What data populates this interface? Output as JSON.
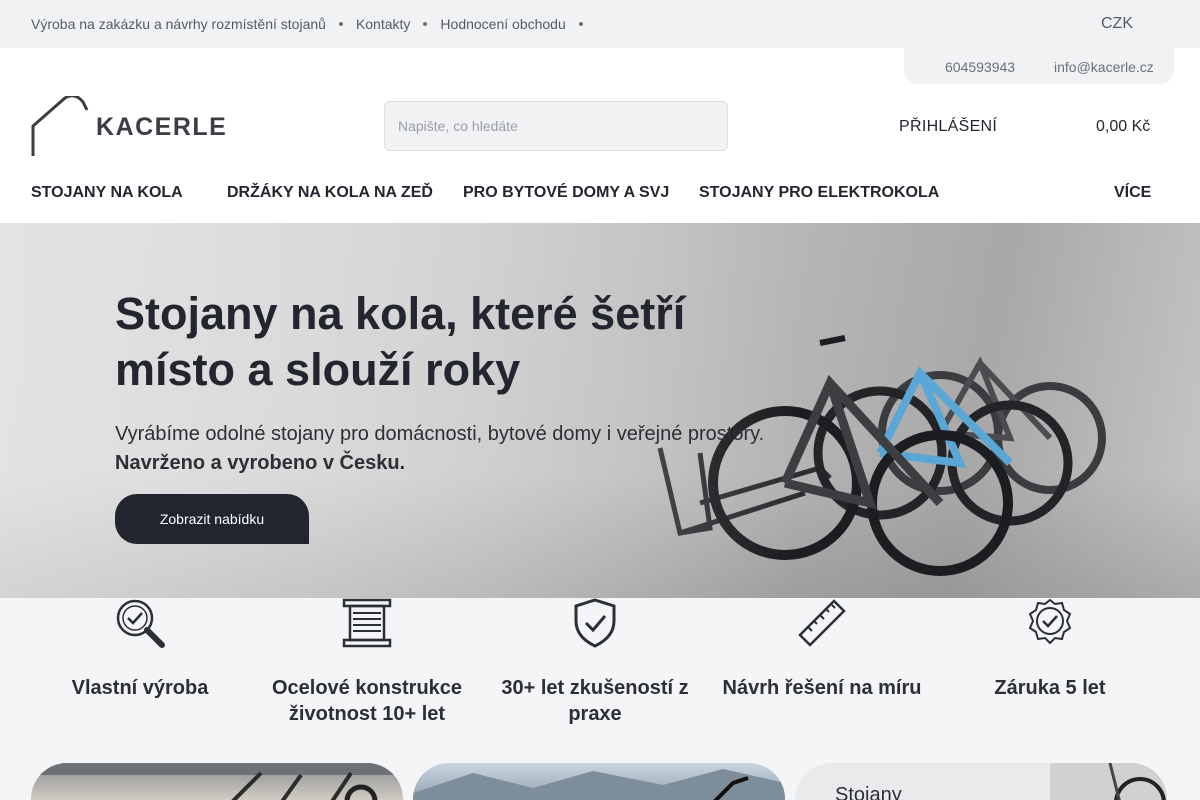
{
  "topbar": {
    "links": [
      "Výroba na zakázku a návrhy rozmístění stojanů",
      "Kontakty",
      "Hodnocení obchodu"
    ],
    "currency": "CZK"
  },
  "contact": {
    "phone": "604593943",
    "email": "info@kacerle.cz"
  },
  "header": {
    "logo_text": "KACERLE",
    "search_placeholder": "Napište, co hledáte",
    "login_label": "PŘIHLÁŠENÍ",
    "cart_total": "0,00 Kč"
  },
  "nav": {
    "items": [
      "STOJANY NA KOLA",
      "DRŽÁKY NA KOLA NA ZEĎ",
      "PRO BYTOVÉ DOMY A SVJ",
      "STOJANY PRO ELEKTROKOLA"
    ],
    "more_label": "VÍCE"
  },
  "hero": {
    "title": "Stojany na kola, které šetří místo a slouží roky",
    "subtitle": "Vyrábíme odolné stojany pro domácnosti, bytové domy i veřejné prostory.",
    "subtitle_bold": "Navrženo a vyrobeno v Česku.",
    "cta_label": "Zobrazit nabídku"
  },
  "features": [
    {
      "icon": "magnifier-check-icon",
      "label": "Vlastní výroba"
    },
    {
      "icon": "steel-coil-icon",
      "label": "Ocelové konstrukce životnost 10+ let"
    },
    {
      "icon": "shield-check-icon",
      "label": "30+ let zkušeností z praxe"
    },
    {
      "icon": "ruler-icon",
      "label": "Návrh řešení na míru"
    },
    {
      "icon": "badge-check-icon",
      "label": "Záruka 5 let"
    }
  ],
  "cards": [
    {
      "title": ""
    },
    {
      "title": ""
    },
    {
      "title": "Stojany"
    }
  ],
  "colors": {
    "primary": "#22252d",
    "background": "#f4f5f7",
    "topbar": "#f1f2f4"
  }
}
